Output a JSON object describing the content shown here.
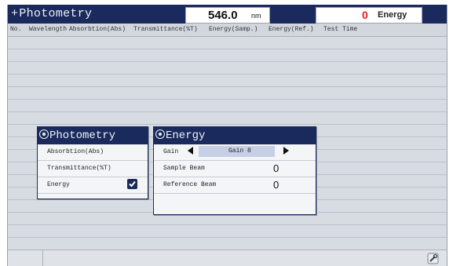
{
  "titlebar": {
    "title_prefix": "+",
    "title": "Photometry",
    "wavelength_value": "546.0",
    "wavelength_unit": "nm",
    "mode_value": "0",
    "mode_label": "Energy",
    "colors": {
      "bar": "#1b2a5c",
      "mode_value": "#e02020"
    }
  },
  "table": {
    "headers": [
      "No.",
      "Wavelength",
      "Absorbtion(Abs)",
      "Transmittance(%T)",
      "Energy(Samp.)",
      "Energy(Ref.)",
      "Test Time"
    ],
    "rows": []
  },
  "photometry_panel": {
    "title": "Photometry",
    "items": [
      {
        "label": "Absorbtion(Abs)",
        "checked": false
      },
      {
        "label": "Transmittance(%T)",
        "checked": false
      },
      {
        "label": "Energy",
        "checked": true
      }
    ]
  },
  "energy_panel": {
    "title": "Energy",
    "gain_label": "Gain",
    "gain_value": "Gain 8",
    "sample_label": "Sample Beam",
    "sample_value": "0",
    "reference_label": "Reference Beam",
    "reference_value": "0"
  },
  "statusbar": {
    "tool_icon": "tools-icon"
  }
}
